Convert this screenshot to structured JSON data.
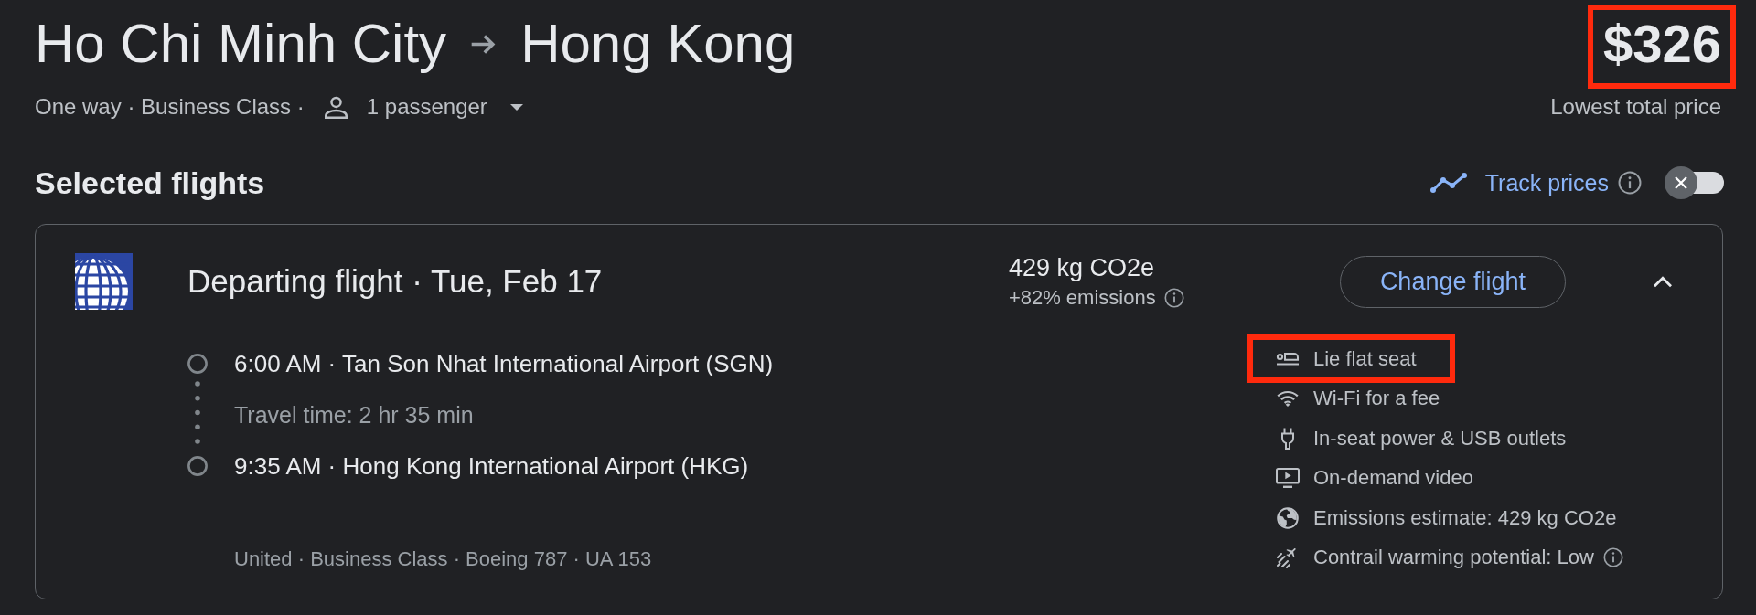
{
  "route": {
    "origin": "Ho Chi Minh City",
    "destination": "Hong Kong"
  },
  "trip": {
    "summary": "One way · Business Class ·",
    "passengers": "1 passenger"
  },
  "price": {
    "amount": "$326",
    "caption": "Lowest total price",
    "highlighted": true
  },
  "section": {
    "title": "Selected flights"
  },
  "track_prices": {
    "label": "Track prices",
    "on": false
  },
  "flights": [
    {
      "title": "Departing flight · Tue, Feb 17",
      "emissions": "429 kg CO2e",
      "emissions_change": "+82% emissions",
      "action": "Change flight",
      "expanded": true,
      "departure": "6:00 AM · Tan Son Nhat International Airport (SGN)",
      "travel_time": "Travel time: 2 hr 35 min",
      "arrival": "9:35 AM · Hong Kong International Airport (HKG)",
      "details": "United · Business Class · Boeing 787 · UA 153",
      "amenities": [
        {
          "kind": "seat",
          "label": "Lie flat seat",
          "info": false,
          "highlighted": true
        },
        {
          "kind": "wifi",
          "label": "Wi-Fi for a fee",
          "info": false,
          "highlighted": false
        },
        {
          "kind": "power",
          "label": "In-seat power & USB outlets",
          "info": false,
          "highlighted": false
        },
        {
          "kind": "video",
          "label": "On-demand video",
          "info": false,
          "highlighted": false
        },
        {
          "kind": "emissions",
          "label": "Emissions estimate: 429 kg CO2e",
          "info": false,
          "highlighted": false
        },
        {
          "kind": "contrail",
          "label": "Contrail warming potential: Low",
          "info": true,
          "highlighted": false
        }
      ]
    }
  ]
}
